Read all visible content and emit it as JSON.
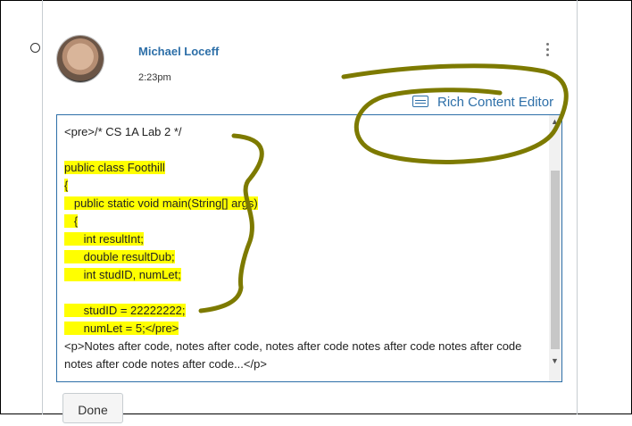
{
  "post": {
    "author": "Michael Loceff",
    "time": "2:23pm"
  },
  "editor": {
    "toggle_label": "Rich Content Editor",
    "code_lines": [
      "<pre>/* CS 1A Lab 2 */",
      "",
      "public class Foothill",
      "{",
      "   public static void main(String[] args)",
      "   {",
      "      int resultInt;",
      "      double resultDub;",
      "      int studID, numLet;",
      "",
      "      studID = 22222222;",
      "      numLet = 5;</pre>"
    ],
    "notes": "<p>Notes after code, notes after code, notes after code notes after code notes after code notes after code notes after code...</p>"
  },
  "actions": {
    "done_label": "Done"
  },
  "colors": {
    "link": "#2d6fa8",
    "highlight": "#ffff00",
    "annotation_ink": "#7d7a00"
  }
}
